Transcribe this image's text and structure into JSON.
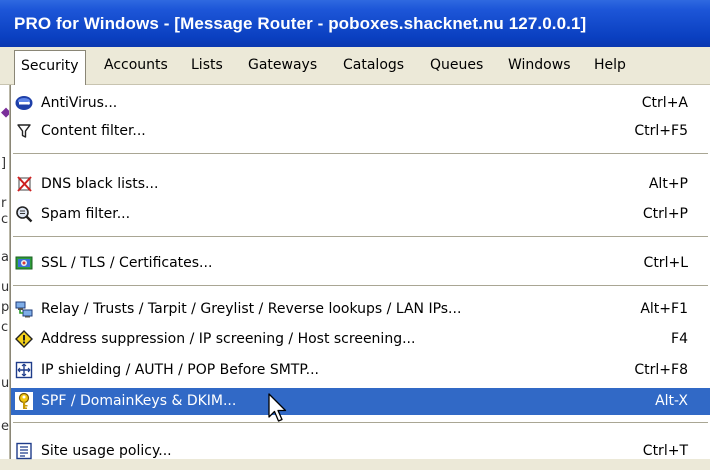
{
  "window": {
    "title": "PRO for Windows - [Message Router - poboxes.shacknet.nu 127.0.0.1]"
  },
  "menubar": {
    "items": [
      {
        "label": "Security",
        "active": true
      },
      {
        "label": "Accounts"
      },
      {
        "label": "Lists"
      },
      {
        "label": "Gateways"
      },
      {
        "label": "Catalogs"
      },
      {
        "label": "Queues"
      },
      {
        "label": "Windows"
      },
      {
        "label": "Help"
      }
    ]
  },
  "background_window": {
    "glyphs": [
      "◆",
      "]",
      "r",
      "c",
      "a",
      "u",
      "p",
      "c",
      "u",
      "e"
    ]
  },
  "security_menu": {
    "items": [
      {
        "label": "AntiVirus...",
        "shortcut": "Ctrl+A",
        "icon": "antivirus-icon"
      },
      {
        "label": "Content filter...",
        "shortcut": "Ctrl+F5",
        "icon": "content-filter-icon"
      },
      {
        "label": "DNS black lists...",
        "shortcut": "Alt+P",
        "icon": "dns-blacklist-icon"
      },
      {
        "label": "Spam filter...",
        "shortcut": "Ctrl+P",
        "icon": "spam-filter-icon"
      },
      {
        "label": "SSL / TLS / Certificates...",
        "shortcut": "Ctrl+L",
        "icon": "certificate-icon"
      },
      {
        "label": "Relay / Trusts / Tarpit / Greylist / Reverse lookups / LAN IPs...",
        "shortcut": "Alt+F1",
        "icon": "relay-icon"
      },
      {
        "label": "Address suppression / IP screening / Host screening...",
        "shortcut": "F4",
        "icon": "warning-diamond-icon"
      },
      {
        "label": "IP shielding / AUTH / POP Before SMTP...",
        "shortcut": "Ctrl+F8",
        "icon": "ip-shield-icon"
      },
      {
        "label": "SPF / DomainKeys & DKIM...",
        "shortcut": "Alt-X",
        "icon": "key-icon",
        "highlighted": true
      },
      {
        "label": "Site usage policy...",
        "shortcut": "Ctrl+T",
        "icon": "policy-icon"
      }
    ]
  },
  "colors": {
    "title_bar": "#0a3fc0",
    "highlight": "#3169c6",
    "menu_background": "#ffffff",
    "chrome": "#ece9d8"
  }
}
